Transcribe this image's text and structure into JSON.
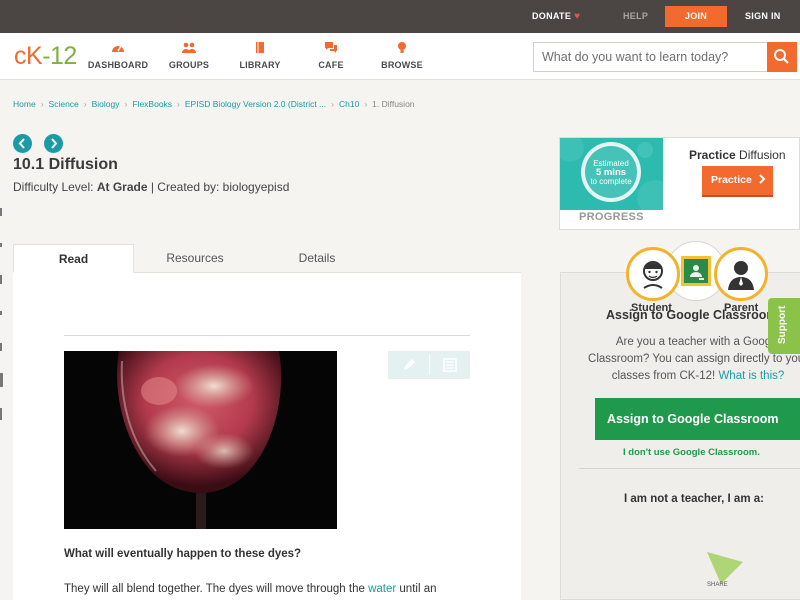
{
  "topbar": {
    "donate": "DONATE",
    "help": "HELP",
    "join": "JOIN",
    "signin": "SIGN IN"
  },
  "logo": {
    "part1": "cK",
    "part2": "-12"
  },
  "nav": {
    "items": [
      {
        "label": "DASHBOARD",
        "icon": "dashboard-icon"
      },
      {
        "label": "GROUPS",
        "icon": "groups-icon"
      },
      {
        "label": "LIBRARY",
        "icon": "library-icon"
      },
      {
        "label": "CAFE",
        "icon": "cafe-icon"
      },
      {
        "label": "BROWSE",
        "icon": "browse-icon"
      }
    ]
  },
  "search": {
    "placeholder": "What do you want to learn today?"
  },
  "breadcrumb": {
    "items": [
      "Home",
      "Science",
      "Biology",
      "FlexBooks",
      "EPISD Biology Version 2.0 (District ...",
      "Ch10"
    ],
    "current": "1. Diffusion"
  },
  "page": {
    "title": "10.1 Diffusion",
    "difficulty_label": "Difficulty Level:",
    "difficulty_value": "At Grade",
    "created_by": "| Created by: biologyepisd"
  },
  "tabs": [
    "Read",
    "Resources",
    "Details"
  ],
  "article": {
    "question": "What will eventually happen to these dyes?",
    "para_start": "They will all blend together. The dyes will move through the ",
    "para_link": "water",
    "para_end": " until an"
  },
  "practice": {
    "estimated": "Estimated",
    "mins": "5 mins",
    "to_complete": "to complete",
    "progress": "PROGRESS",
    "title_bold": "Practice",
    "title_rest": " Diffusion",
    "button": "Practice"
  },
  "assign": {
    "heading": "Assign to Google Classroom",
    "para1": "Are you a teacher with a Google",
    "para2": "Classroom? You can assign directly to your",
    "para3": "classes from CK-12! ",
    "para_link": "What is this?",
    "button": "Assign to Google Classroom",
    "no_classroom": "I don't use Google Classroom.",
    "not_teacher": "I am not a teacher, I am a:",
    "student": "Student",
    "parent": "Parent"
  },
  "support": "Support",
  "share": "SHARE",
  "colors": {
    "brand_orange": "#f26a2e",
    "teal": "#1a9ba5",
    "green": "#1f9a4c",
    "support_green": "#8bc34a",
    "topbar": "#4b4643"
  }
}
